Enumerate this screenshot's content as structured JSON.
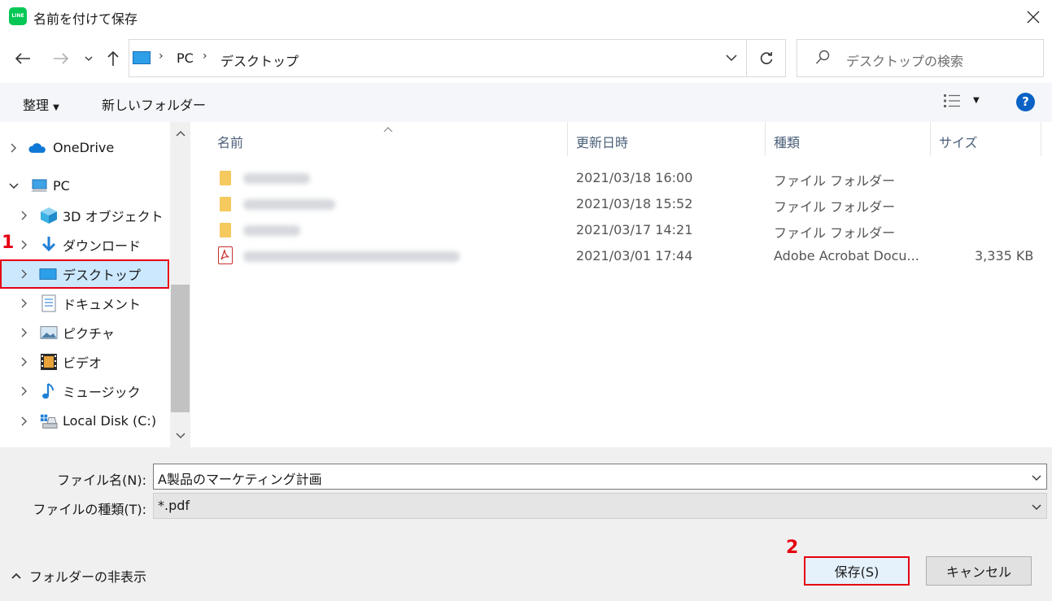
{
  "window": {
    "app_icon_text": "LINE",
    "title": "名前を付けて保存"
  },
  "address_bar": {
    "crumbs": [
      "PC",
      "デスクトップ"
    ]
  },
  "search": {
    "placeholder": "デスクトップの検索"
  },
  "commands": {
    "organize": "整理",
    "new_folder": "新しいフォルダー",
    "help": "?"
  },
  "nav_pane": {
    "items": [
      {
        "label": "OneDrive",
        "icon": "cloud-icon"
      },
      {
        "label": "PC",
        "icon": "computer-icon"
      },
      {
        "label": "3D オブジェクト",
        "icon": "cube-icon"
      },
      {
        "label": "ダウンロード",
        "icon": "download-icon"
      },
      {
        "label": "デスクトップ",
        "icon": "desktop-icon"
      },
      {
        "label": "ドキュメント",
        "icon": "document-icon"
      },
      {
        "label": "ピクチャ",
        "icon": "picture-icon"
      },
      {
        "label": "ビデオ",
        "icon": "video-icon"
      },
      {
        "label": "ミュージック",
        "icon": "music-icon"
      },
      {
        "label": "Local Disk (C:)",
        "icon": "disk-icon"
      }
    ],
    "selected": "デスクトップ"
  },
  "file_list": {
    "columns": [
      "名前",
      "更新日時",
      "種類",
      "サイズ"
    ],
    "rows": [
      {
        "name": "",
        "modified": "2021/03/18 16:00",
        "type": "ファイル フォルダー",
        "size": "",
        "icon": "folder-icon"
      },
      {
        "name": "",
        "modified": "2021/03/18 15:52",
        "type": "ファイル フォルダー",
        "size": "",
        "icon": "folder-icon"
      },
      {
        "name": "",
        "modified": "2021/03/17 14:21",
        "type": "ファイル フォルダー",
        "size": "",
        "icon": "folder-icon"
      },
      {
        "name": "",
        "modified": "2021/03/01 17:44",
        "type": "Adobe Acrobat Docu...",
        "size": "3,335 KB",
        "icon": "pdf-icon"
      }
    ]
  },
  "form": {
    "filename_label": "ファイル名(N):",
    "filename_value": "A製品のマーケティング計画",
    "filetype_label": "ファイルの種類(T):",
    "filetype_value": "*.pdf"
  },
  "buttons": {
    "save": "保存(S)",
    "cancel": "キャンセル"
  },
  "folder_toggle": "フォルダーの非表示",
  "annotations": {
    "step1": "1",
    "step2": "2"
  },
  "colors": {
    "highlight_border": "#e60012",
    "selected_bg": "#cce8ff",
    "line_green": "#06c755",
    "help_blue": "#0b62c4"
  }
}
